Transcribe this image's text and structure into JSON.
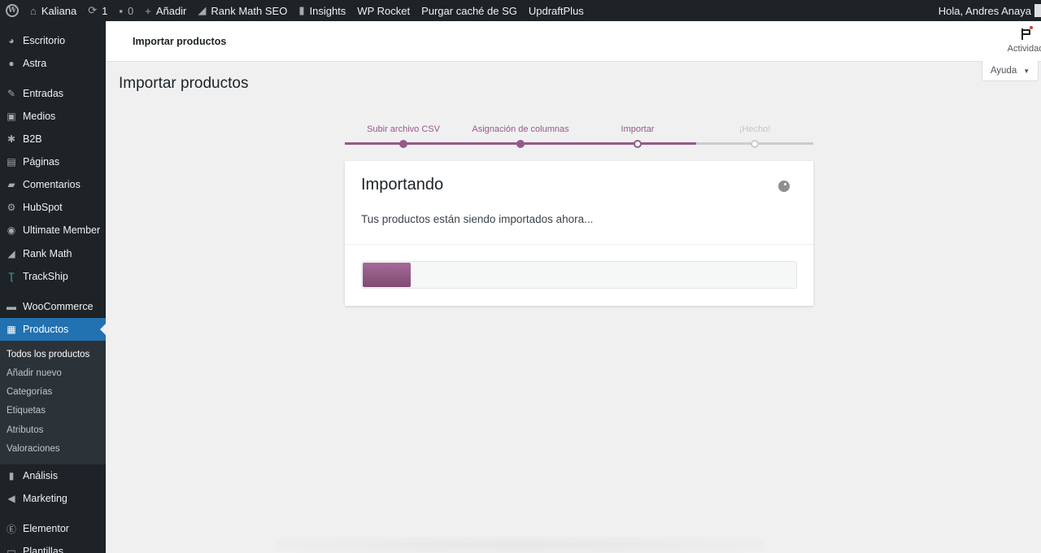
{
  "admin_bar": {
    "site_name": "Kaliana",
    "updates_count": "1",
    "comments_count": "0",
    "new_label": "Añadir",
    "rank_math_label": "Rank Math SEO",
    "insights_label": "Insights",
    "wp_rocket_label": "WP Rocket",
    "purge_label": "Purgar caché de SG",
    "updraft_label": "UpdraftPlus",
    "greeting": "Hola, Andres Anaya"
  },
  "sidebar": {
    "items": [
      {
        "label": "Escritorio",
        "icon": "dashboard-icon"
      },
      {
        "label": "Astra",
        "icon": "astra-icon"
      },
      {
        "label": "Entradas",
        "icon": "pin-icon"
      },
      {
        "label": "Medios",
        "icon": "media-icon"
      },
      {
        "label": "B2B",
        "icon": "groups-icon"
      },
      {
        "label": "Páginas",
        "icon": "pages-icon"
      },
      {
        "label": "Comentarios",
        "icon": "comments-icon"
      },
      {
        "label": "HubSpot",
        "icon": "hubspot-icon"
      },
      {
        "label": "Ultimate Member",
        "icon": "user-icon"
      },
      {
        "label": "Rank Math",
        "icon": "rank-math-icon"
      },
      {
        "label": "TrackShip",
        "icon": "trackship-icon"
      },
      {
        "label": "WooCommerce",
        "icon": "woo-icon"
      },
      {
        "label": "Productos",
        "icon": "archive-icon"
      },
      {
        "label": "Análisis",
        "icon": "chart-icon"
      },
      {
        "label": "Marketing",
        "icon": "megaphone-icon"
      },
      {
        "label": "Elementor",
        "icon": "elementor-icon"
      },
      {
        "label": "Plantillas",
        "icon": "folder-icon"
      }
    ],
    "submenu": [
      "Todos los productos",
      "Añadir nuevo",
      "Categorías",
      "Etiquetas",
      "Atributos",
      "Valoraciones"
    ]
  },
  "header": {
    "title": "Importar productos",
    "activity_label": "Actividad"
  },
  "help_label": "Ayuda",
  "page_title": "Importar productos",
  "steps": [
    {
      "label": "Subir archivo CSV",
      "state": "done"
    },
    {
      "label": "Asignación de columnas",
      "state": "done"
    },
    {
      "label": "Importar",
      "state": "active"
    },
    {
      "label": "¡Hecho!",
      "state": "pending"
    }
  ],
  "card": {
    "title": "Importando",
    "text": "Tus productos están siendo importados ahora..."
  },
  "progress": {
    "percent": 11
  },
  "colors": {
    "accent": "#96588a",
    "admin_bg": "#1d2327",
    "current_menu": "#2271b1"
  }
}
